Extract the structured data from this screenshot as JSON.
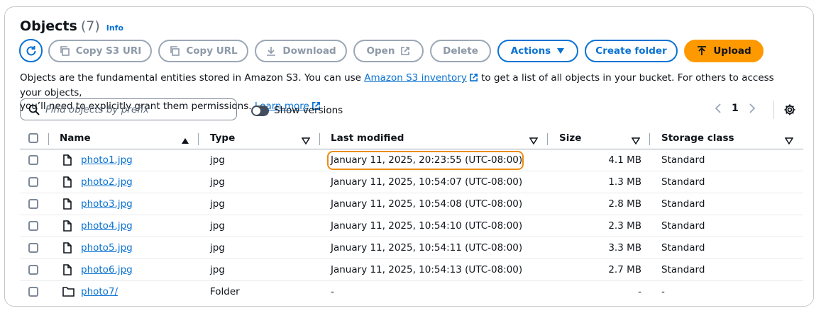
{
  "header": {
    "title": "Objects",
    "count": "(7)",
    "info": "Info"
  },
  "toolbar": {
    "copy_uri": "Copy S3 URI",
    "copy_url": "Copy URL",
    "download": "Download",
    "open": "Open",
    "delete": "Delete",
    "actions": "Actions",
    "create_folder": "Create folder",
    "upload": "Upload"
  },
  "description": {
    "text1": "Objects are the fundamental entities stored in Amazon S3. You can use ",
    "link1": "Amazon S3 inventory",
    "text2": " to get a list of all objects in your bucket. For others to access your objects,",
    "text3": "you’ll need to explicitly grant them permissions. ",
    "link2": "Learn more"
  },
  "search": {
    "placeholder": "Find objects by prefix"
  },
  "versions_toggle": {
    "label": "Show versions",
    "on": false
  },
  "pagination": {
    "page": "1"
  },
  "table": {
    "columns": [
      "Name",
      "Type",
      "Last modified",
      "Size",
      "Storage class"
    ],
    "rows": [
      {
        "name": "photo1.jpg",
        "type": "jpg",
        "modified": "January 11, 2025, 20:23:55 (UTC-08:00)",
        "size": "4.1 MB",
        "storage": "Standard",
        "kind": "file"
      },
      {
        "name": "photo2.jpg",
        "type": "jpg",
        "modified": "January 11, 2025, 10:54:07 (UTC-08:00)",
        "size": "1.3 MB",
        "storage": "Standard",
        "kind": "file"
      },
      {
        "name": "photo3.jpg",
        "type": "jpg",
        "modified": "January 11, 2025, 10:54:08 (UTC-08:00)",
        "size": "2.8 MB",
        "storage": "Standard",
        "kind": "file"
      },
      {
        "name": "photo4.jpg",
        "type": "jpg",
        "modified": "January 11, 2025, 10:54:10 (UTC-08:00)",
        "size": "2.3 MB",
        "storage": "Standard",
        "kind": "file"
      },
      {
        "name": "photo5.jpg",
        "type": "jpg",
        "modified": "January 11, 2025, 10:54:11 (UTC-08:00)",
        "size": "3.3 MB",
        "storage": "Standard",
        "kind": "file"
      },
      {
        "name": "photo6.jpg",
        "type": "jpg",
        "modified": "January 11, 2025, 10:54:13 (UTC-08:00)",
        "size": "2.7 MB",
        "storage": "Standard",
        "kind": "file"
      },
      {
        "name": "photo7/",
        "type": "Folder",
        "modified": "-",
        "size": "-",
        "storage": "-",
        "kind": "folder"
      }
    ]
  },
  "colors": {
    "link": "#0972d3",
    "upload": "#ff9900",
    "highlight": "#ec8c13"
  }
}
